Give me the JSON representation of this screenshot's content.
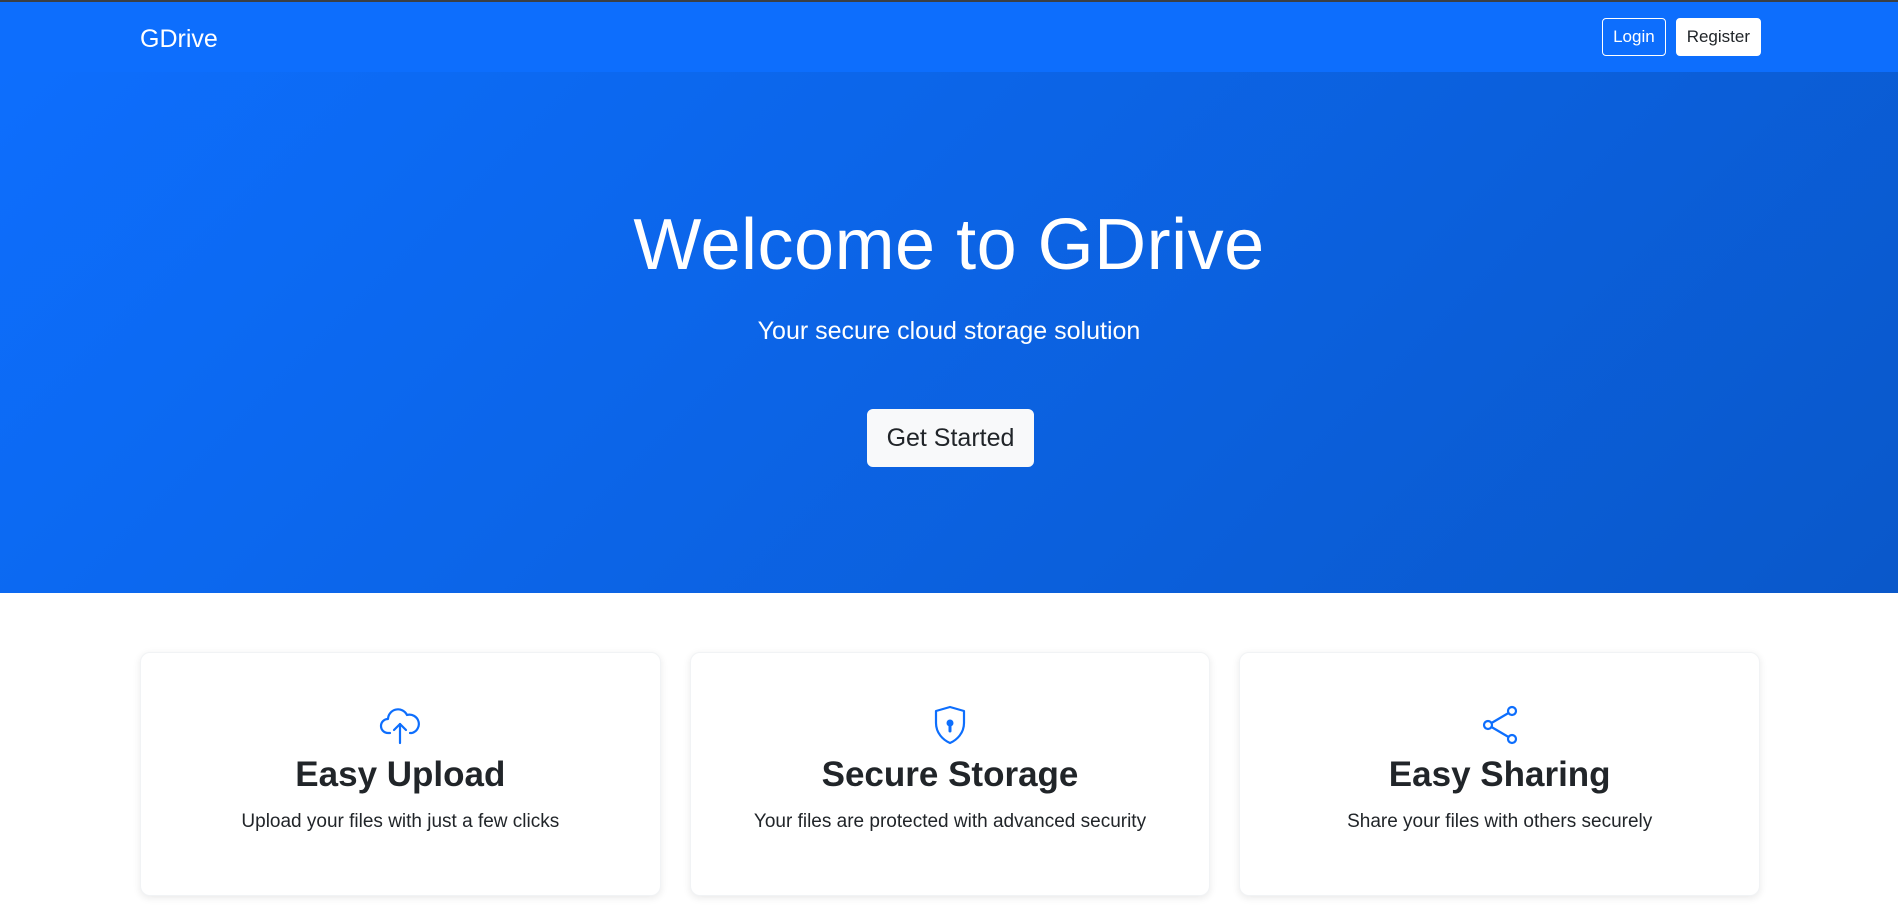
{
  "navbar": {
    "brand": "GDrive",
    "login_label": "Login",
    "register_label": "Register"
  },
  "hero": {
    "title": "Welcome to GDrive",
    "subtitle": "Your secure cloud storage solution",
    "cta_label": "Get Started"
  },
  "features": [
    {
      "icon": "cloud-upload-icon",
      "title": "Easy Upload",
      "text": "Upload your files with just a few clicks"
    },
    {
      "icon": "shield-lock-icon",
      "title": "Secure Storage",
      "text": "Your files are protected with advanced security"
    },
    {
      "icon": "share-icon",
      "title": "Easy Sharing",
      "text": "Share your files with others securely"
    }
  ],
  "colors": {
    "primary": "#0d6efd",
    "primary_dark": "#0a58ca",
    "text": "#212529",
    "light": "#f8f9fa"
  }
}
